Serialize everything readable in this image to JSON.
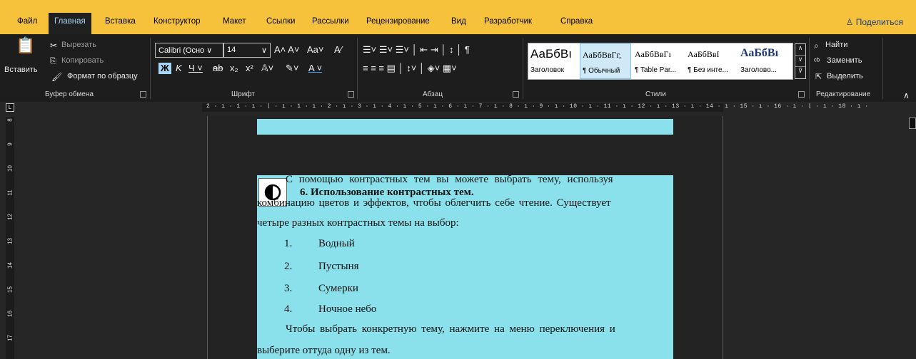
{
  "tabs": [
    "Файл",
    "Главная",
    "Вставка",
    "Конструктор",
    "Макет",
    "Ссылки",
    "Рассылки",
    "Рецензирование",
    "Вид",
    "Разработчик",
    "Справка"
  ],
  "share_label": "Поделиться",
  "clipboard": {
    "paste": "Вставить",
    "cut": "Вырезать",
    "copy": "Копировать",
    "format_painter": "Формат по образцу",
    "group": "Буфер обмена"
  },
  "font": {
    "name": "Calibri (Осно",
    "size": "14",
    "group": "Шрифт"
  },
  "paragraph": {
    "group": "Абзац"
  },
  "styles": {
    "group": "Стили",
    "items": [
      {
        "preview": "АаБбВı",
        "name": "Заголовок"
      },
      {
        "preview": "АаБбВвГг,",
        "name": "¶ Обычный"
      },
      {
        "preview": "АаБбВвГı",
        "name": "¶ Table Par..."
      },
      {
        "preview": "АаБбВвI",
        "name": "¶ Без инте..."
      },
      {
        "preview": "АаБбВı",
        "name": "Заголово..."
      }
    ]
  },
  "editing": {
    "find": "Найти",
    "replace": "Заменить",
    "select": "Выделить",
    "group": "Редактирование"
  },
  "ruler": {
    "h": "2 · ı · 1 · ı · ⌊ · ı · 1 · ı · 2 · ı · 3 · ı · 4 · ı · 5 · ı · 6 · ı · 7 · ı · 8 · ı · 9 · ı · 10 · ı · 11 · ı · 12 · ı · 13 · ı · 14 · ı · 15 · ı · 16 · ı · ⌊ · ı · 18 · ı ·",
    "v": [
      "8",
      "9",
      "10",
      "11",
      "12",
      "13",
      "14",
      "15",
      "16",
      "17"
    ]
  },
  "doc": {
    "heading": "6. Использование контрастных тем.",
    "p1": [
      "С помощью контрастных тем вы можете выбрать тему, используя",
      "комбинацию цветов и эффектов, чтобы облегчить себе чтение. Существует",
      "четыре разных контрастных темы на выбор:"
    ],
    "list": [
      {
        "n": "1.",
        "t": "Водный"
      },
      {
        "n": "2.",
        "t": "Пустыня"
      },
      {
        "n": "3.",
        "t": "Сумерки"
      },
      {
        "n": "4.",
        "t": "Ночное небо"
      }
    ],
    "p2": [
      "Чтобы выбрать конкретную тему, нажмите на меню переключения и",
      "выберите оттуда одну из тем."
    ]
  },
  "colors": {
    "accent": "#f6c23b",
    "doc_highlight": "#8ae1ec",
    "background": "#262626"
  }
}
